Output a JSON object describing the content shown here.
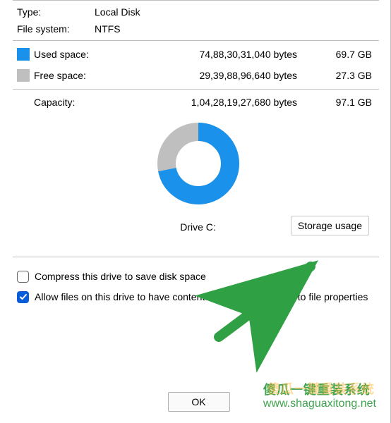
{
  "info": {
    "type_label": "Type:",
    "type_value": "Local Disk",
    "fs_label": "File system:",
    "fs_value": "NTFS"
  },
  "space": {
    "used_label": "Used space:",
    "used_bytes": "74,88,30,31,040 bytes",
    "used_gb": "69.7 GB",
    "free_label": "Free space:",
    "free_bytes": "29,39,88,96,640 bytes",
    "free_gb": "27.3 GB",
    "capacity_label": "Capacity:",
    "capacity_bytes": "1,04,28,19,27,680 bytes",
    "capacity_gb": "97.1 GB"
  },
  "drive": {
    "label": "Drive C:",
    "storage_btn": "Storage usage"
  },
  "options": {
    "compress_label": "Compress this drive to save disk space",
    "index_label": "Allow files on this drive to have contents indexed in addition to file properties"
  },
  "buttons": {
    "ok": "OK"
  },
  "watermark": {
    "cn": "傻瓜一键重装系统",
    "url": "www.shaguaxitong.net"
  },
  "colors": {
    "used": "#1a91ea",
    "free": "#bfbfbf",
    "accent": "#0a5dd8",
    "arrow": "#2fa043"
  },
  "chart_data": {
    "type": "pie",
    "title": "Drive C:",
    "series": [
      {
        "name": "Used space",
        "value": 69.7,
        "unit": "GB",
        "color": "#1a91ea"
      },
      {
        "name": "Free space",
        "value": 27.3,
        "unit": "GB",
        "color": "#bfbfbf"
      }
    ],
    "total": {
      "name": "Capacity",
      "value": 97.1,
      "unit": "GB"
    }
  }
}
